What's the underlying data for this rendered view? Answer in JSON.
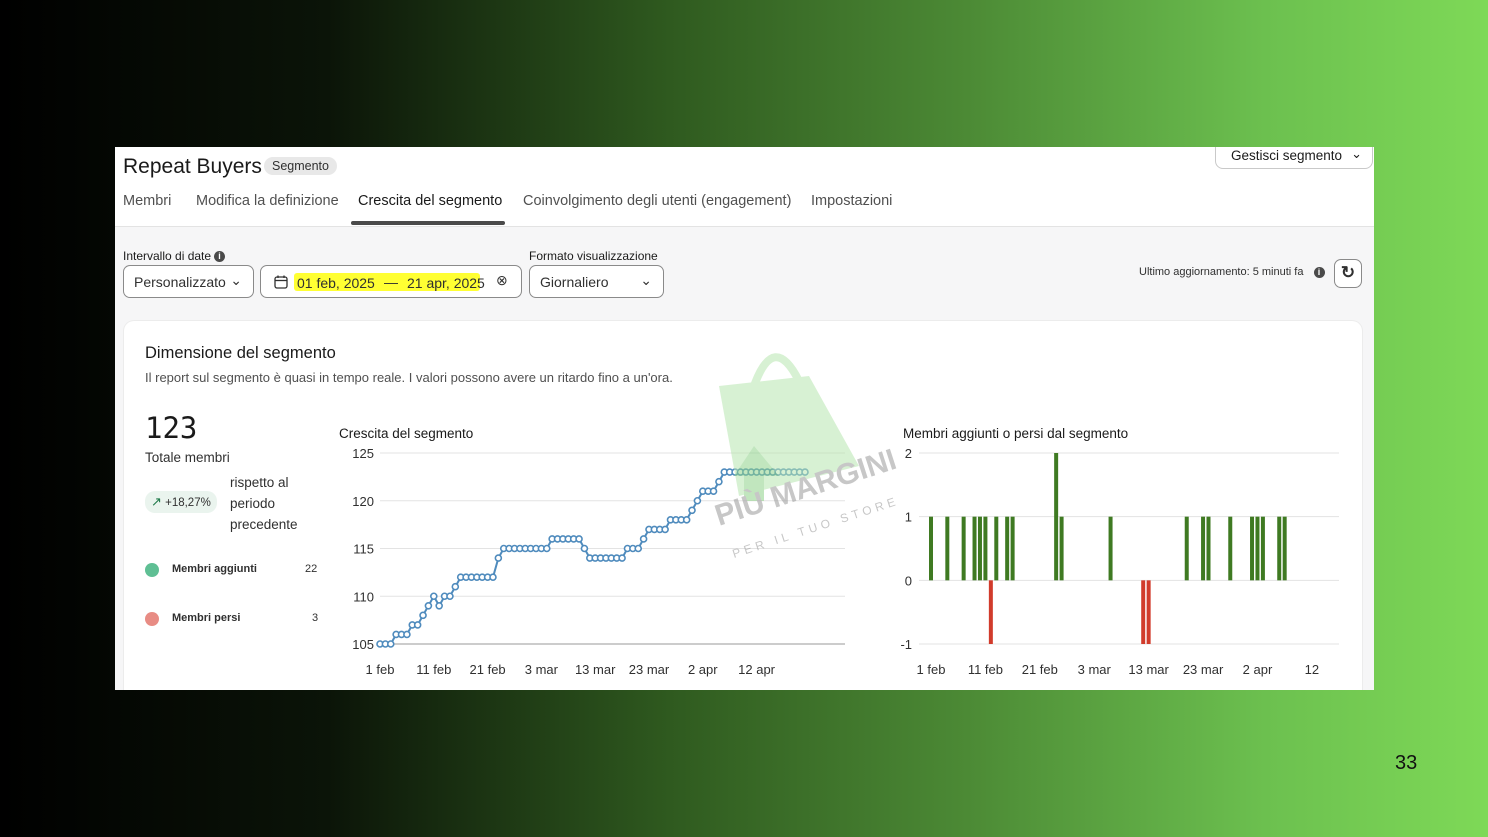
{
  "page_number": "33",
  "header": {
    "title": "Repeat Buyers",
    "badge": "Segmento",
    "manage_button": "Gestisci segmento",
    "tabs": [
      {
        "label": "Membri"
      },
      {
        "label": "Modifica la definizione"
      },
      {
        "label": "Crescita del segmento",
        "active": true
      },
      {
        "label": "Coinvolgimento degli utenti (engagement)"
      },
      {
        "label": "Impostazioni"
      }
    ]
  },
  "filters": {
    "date_range_label": "Intervallo di date",
    "date_preset": "Personalizzato",
    "date_start": "01 feb, 2025",
    "date_separator": "—",
    "date_end": "21 apr, 2025",
    "format_label": "Formato visualizzazione",
    "format_value": "Giornaliero",
    "last_update": "Ultimo aggiornamento: 5 minuti fa"
  },
  "card": {
    "title": "Dimensione del segmento",
    "subtitle": "Il report sul segmento è quasi in tempo reale. I valori possono avere un ritardo fino a un'ora.",
    "total_value": "123",
    "total_label": "Totale membri",
    "change_pct": "+18,27%",
    "compare_text": "rispetto al periodo precedente",
    "legend": [
      {
        "label": "Membri aggiunti",
        "value": "22",
        "color": "#5fbf94"
      },
      {
        "label": "Membri persi",
        "value": "3",
        "color": "#e88c84"
      }
    ]
  },
  "watermark": {
    "brand": "PIÙ MARGINI",
    "tagline": "PER IL TUO STORE"
  },
  "chart_data": [
    {
      "type": "line",
      "title": "Crescita del segmento",
      "ylim": [
        105,
        125
      ],
      "yticks": [
        "105",
        "110",
        "115",
        "120",
        "125"
      ],
      "xticks": [
        "1 feb",
        "11 feb",
        "21 feb",
        "3 mar",
        "13 mar",
        "23 mar",
        "2 apr",
        "12 apr"
      ],
      "x_days_range": [
        0,
        79
      ],
      "color": "#4f8bbd",
      "points_day_value": [
        [
          0,
          105
        ],
        [
          1,
          105
        ],
        [
          2,
          105
        ],
        [
          3,
          106
        ],
        [
          4,
          106
        ],
        [
          5,
          106
        ],
        [
          6,
          107
        ],
        [
          7,
          107
        ],
        [
          8,
          108
        ],
        [
          9,
          109
        ],
        [
          10,
          110
        ],
        [
          11,
          109
        ],
        [
          12,
          110
        ],
        [
          13,
          110
        ],
        [
          14,
          111
        ],
        [
          15,
          112
        ],
        [
          16,
          112
        ],
        [
          17,
          112
        ],
        [
          18,
          112
        ],
        [
          19,
          112
        ],
        [
          20,
          112
        ],
        [
          21,
          112
        ],
        [
          22,
          114
        ],
        [
          23,
          115
        ],
        [
          24,
          115
        ],
        [
          25,
          115
        ],
        [
          26,
          115
        ],
        [
          27,
          115
        ],
        [
          28,
          115
        ],
        [
          29,
          115
        ],
        [
          30,
          115
        ],
        [
          31,
          115
        ],
        [
          32,
          116
        ],
        [
          33,
          116
        ],
        [
          34,
          116
        ],
        [
          35,
          116
        ],
        [
          36,
          116
        ],
        [
          37,
          116
        ],
        [
          38,
          115
        ],
        [
          39,
          114
        ],
        [
          40,
          114
        ],
        [
          41,
          114
        ],
        [
          42,
          114
        ],
        [
          43,
          114
        ],
        [
          44,
          114
        ],
        [
          45,
          114
        ],
        [
          46,
          115
        ],
        [
          47,
          115
        ],
        [
          48,
          115
        ],
        [
          49,
          116
        ],
        [
          50,
          117
        ],
        [
          51,
          117
        ],
        [
          52,
          117
        ],
        [
          53,
          117
        ],
        [
          54,
          118
        ],
        [
          55,
          118
        ],
        [
          56,
          118
        ],
        [
          57,
          118
        ],
        [
          58,
          119
        ],
        [
          59,
          120
        ],
        [
          60,
          121
        ],
        [
          61,
          121
        ],
        [
          62,
          121
        ],
        [
          63,
          122
        ],
        [
          64,
          123
        ],
        [
          65,
          123
        ],
        [
          66,
          123
        ],
        [
          67,
          123
        ],
        [
          68,
          123
        ],
        [
          69,
          123
        ],
        [
          70,
          123
        ],
        [
          71,
          123
        ],
        [
          72,
          123
        ],
        [
          73,
          123
        ],
        [
          74,
          123
        ],
        [
          75,
          123
        ],
        [
          76,
          123
        ],
        [
          77,
          123
        ],
        [
          78,
          123
        ],
        [
          79,
          123
        ]
      ]
    },
    {
      "type": "bar",
      "title": "Membri aggiunti o persi dal segmento",
      "ylim": [
        -1,
        2
      ],
      "yticks": [
        "2",
        "1",
        "0",
        "-1"
      ],
      "xticks": [
        "1 feb",
        "11 feb",
        "21 feb",
        "3 mar",
        "13 mar",
        "23 mar",
        "2 apr",
        "12"
      ],
      "x_days_range": [
        0,
        68
      ],
      "positive_color": "#3f7a22",
      "negative_color": "#d13b2b",
      "bars_day_value": [
        [
          0,
          1
        ],
        [
          3,
          1
        ],
        [
          6,
          1
        ],
        [
          8,
          1
        ],
        [
          9,
          1
        ],
        [
          10,
          1
        ],
        [
          11,
          -1
        ],
        [
          12,
          1
        ],
        [
          14,
          1
        ],
        [
          15,
          1
        ],
        [
          23,
          2
        ],
        [
          24,
          1
        ],
        [
          33,
          1
        ],
        [
          39,
          -1
        ],
        [
          40,
          -1
        ],
        [
          47,
          1
        ],
        [
          50,
          1
        ],
        [
          51,
          1
        ],
        [
          55,
          1
        ],
        [
          59,
          1
        ],
        [
          60,
          1
        ],
        [
          61,
          1
        ],
        [
          64,
          1
        ],
        [
          65,
          1
        ]
      ]
    }
  ]
}
